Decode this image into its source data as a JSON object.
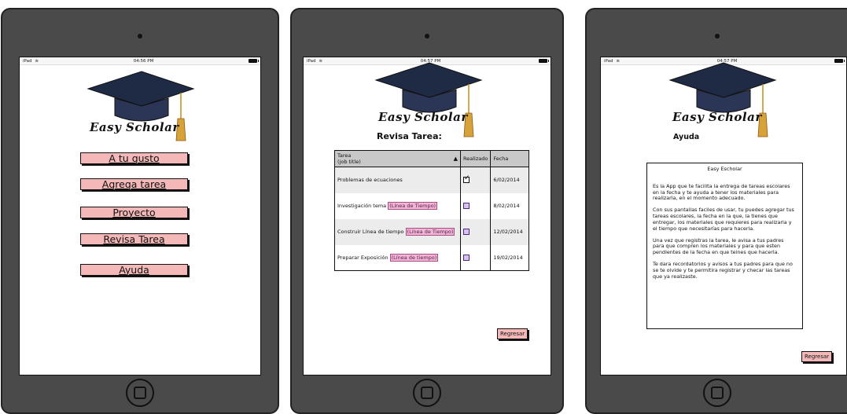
{
  "statusbar": {
    "device": "iPad",
    "time_left": "04:56 PM",
    "time": "04:57 PM"
  },
  "app": {
    "name": "Easy Scholar"
  },
  "screen1": {
    "menu": [
      {
        "label": "A tu gusto"
      },
      {
        "label": "Agrega tarea"
      },
      {
        "label": "Proyecto"
      },
      {
        "label": "Revisa Tarea"
      },
      {
        "label": "Ayuda"
      }
    ]
  },
  "screen2": {
    "heading": "Revisa Tarea:",
    "table": {
      "headers": {
        "task_line1": "Tarea",
        "task_line2": "(job title)",
        "done": "Realizado",
        "date": "Fecha"
      },
      "rows": [
        {
          "task": "Problemas de ecuaciones",
          "link": "",
          "done": true,
          "date": "6/02/2014"
        },
        {
          "task": "Investigación tema",
          "link": "(Línea de Tiempo)",
          "done": false,
          "date": "8/02/2014"
        },
        {
          "task": "Construir Línea de tiempo",
          "link": "(Línea de Tiempo)",
          "done": false,
          "date": "12/02/2014"
        },
        {
          "task": "Preparar Exposición",
          "link": "(Línea de tiempo)",
          "done": false,
          "date": "19/02/2014"
        }
      ]
    },
    "back_label": "Regresar"
  },
  "screen3": {
    "heading": "Ayuda",
    "box_title": "Easy Escholar",
    "paragraphs": [
      "Es la App que te facilita la entrega de tareas escolares en la fecha y te ayuda a tener los materiales para realizarla, en el momento adecuado.",
      "Con sus pantallas faciles de usar, tu puedes agregar tus tareas escolares, la fecha en la que,  la tienes que entregar, los materiales que requieres para realizarla y el tiempo que necesitarías para hacerla.",
      "Una vez que registras la tarea, le avisa a tus padres para que compren los materiales y para que esten pendientes de la fecha en que teines que hacerla.",
      "Te dara recordatorios y avisos a tus padres para que no se te olvide y te permitira registrar y checar las tareas que ya realizaste."
    ],
    "back_label": "Regresar"
  },
  "colors": {
    "button_pink": "#f4b8b8",
    "link_pink": "#f0b7d4",
    "frame_gray": "#4a4a4a"
  }
}
